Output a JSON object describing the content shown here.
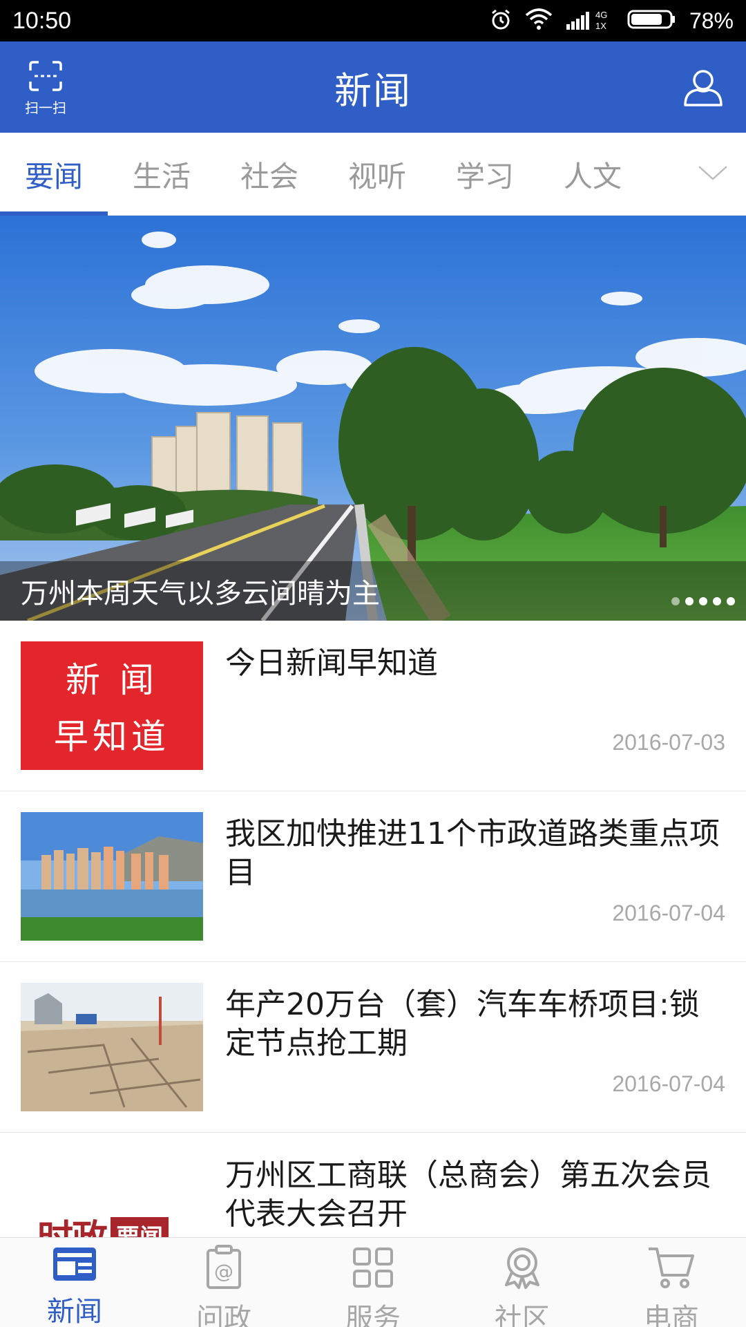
{
  "status_bar": {
    "time": "10:50",
    "network": "4G",
    "sim": "1X",
    "battery": "78%"
  },
  "header": {
    "title": "新闻",
    "scan_label": "扫一扫"
  },
  "tabs": [
    {
      "label": "要闻",
      "active": true
    },
    {
      "label": "生活",
      "active": false
    },
    {
      "label": "社会",
      "active": false
    },
    {
      "label": "视听",
      "active": false
    },
    {
      "label": "学习",
      "active": false
    },
    {
      "label": "人文",
      "active": false
    }
  ],
  "banner": {
    "caption": "万州本周天气以多云间晴为主",
    "dots_total": 5,
    "dot_active": 0
  },
  "news": [
    {
      "title": "今日新闻早知道",
      "date": "2016-07-03",
      "thumb_text": [
        "新 闻",
        "早知道"
      ]
    },
    {
      "title": "我区加快推进11个市政道路类重点项目",
      "date": "2016-07-04"
    },
    {
      "title": "年产20万台（套）汽车车桥项目:锁定节点抢工期",
      "date": "2016-07-04"
    },
    {
      "title": "万州区工商联（总商会）第五次会员代表大会召开",
      "date": "",
      "thumb_text": [
        "时政",
        "要闻"
      ]
    }
  ],
  "bottom_nav": [
    {
      "label": "新闻",
      "icon": "news-icon",
      "active": true
    },
    {
      "label": "问政",
      "icon": "clipboard-at-icon",
      "active": false
    },
    {
      "label": "服务",
      "icon": "grid-icon",
      "active": false
    },
    {
      "label": "社区",
      "icon": "community-icon",
      "active": false
    },
    {
      "label": "电商",
      "icon": "cart-icon",
      "active": false
    }
  ],
  "colors": {
    "brand": "#2f5fc6",
    "inactive": "#a6a6a6",
    "date": "#a8a8a8"
  }
}
